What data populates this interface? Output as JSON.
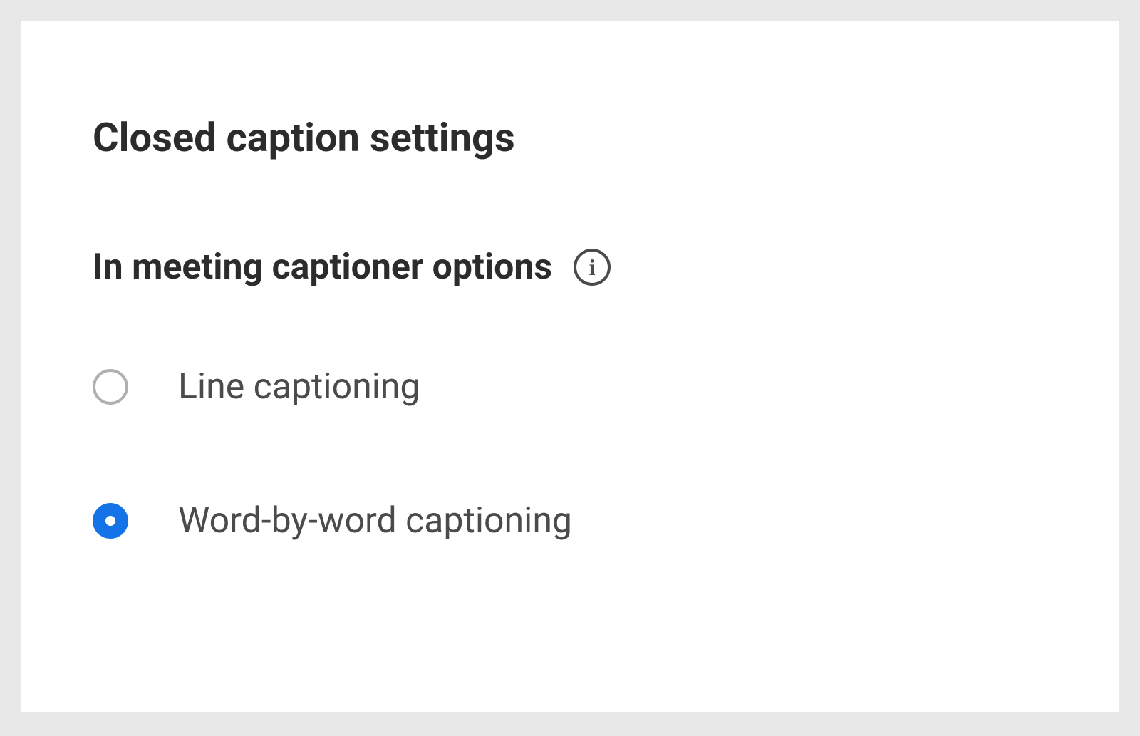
{
  "settings": {
    "heading": "Closed caption settings",
    "subheading": "In meeting captioner options",
    "options": [
      {
        "label": "Line captioning",
        "selected": false
      },
      {
        "label": "Word-by-word captioning",
        "selected": true
      }
    ]
  }
}
